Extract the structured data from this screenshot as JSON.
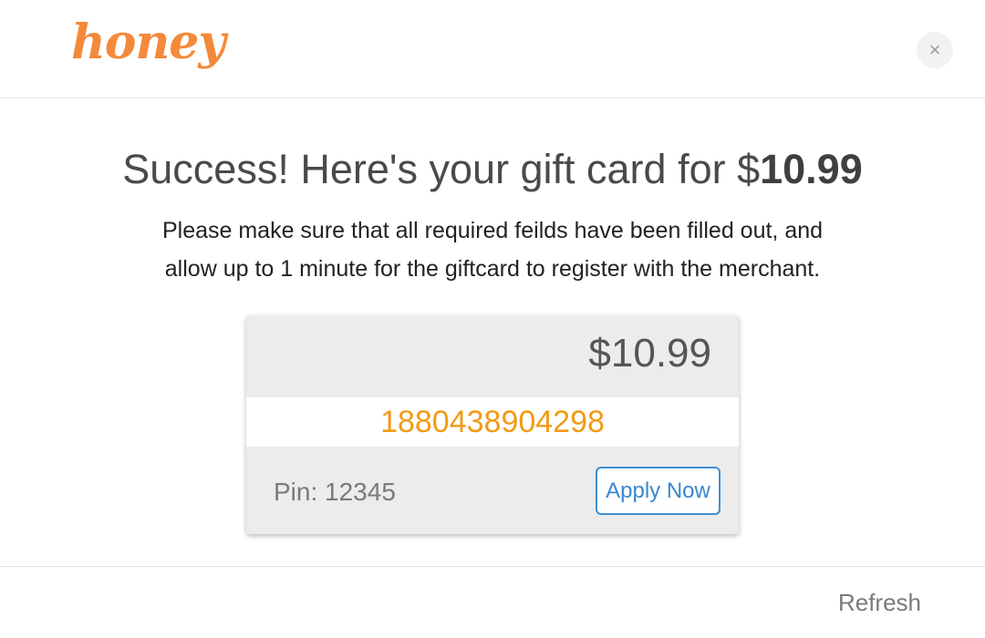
{
  "header": {
    "logo_text": "honey",
    "close_label": "×"
  },
  "main": {
    "title_prefix": "Success! Here's your gift card for $",
    "title_amount": "10.99",
    "subtitle_line1": "Please make sure that all required feilds have been filled out, and",
    "subtitle_line2": "allow up to 1 minute for the giftcard to register with the merchant."
  },
  "card": {
    "amount": "$10.99",
    "code": "1880438904298",
    "pin": "Pin: 12345",
    "apply_label": "Apply Now"
  },
  "footer": {
    "refresh_label": "Refresh"
  },
  "colors": {
    "brand": "#f4893b",
    "code": "#f19b13",
    "accent": "#3f8fd2"
  }
}
